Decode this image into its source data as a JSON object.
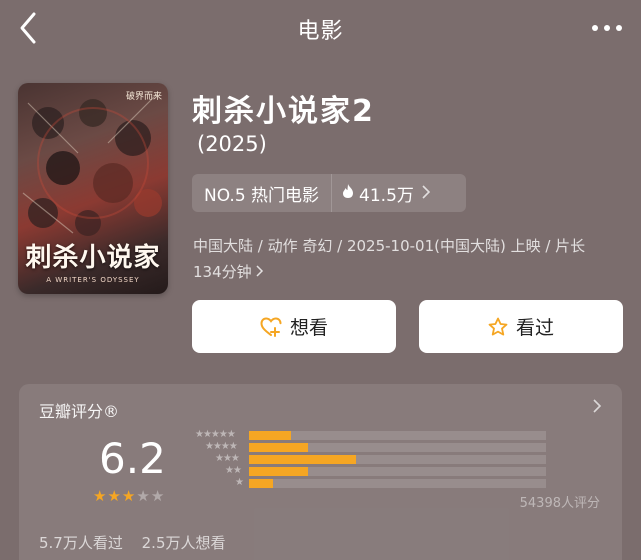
{
  "nav": {
    "title": "电影",
    "back_icon": "back-chevron-icon",
    "more_icon": "more-dots-icon"
  },
  "movie": {
    "title": "刺杀小说家2",
    "year": "(2025)",
    "poster": {
      "title": "刺杀小说家",
      "tag": "破界而来",
      "subtitle": "A WRITER'S ODYSSEY"
    },
    "rank": "NO.5 热门电影",
    "heat": "41.5万",
    "meta_line1": "中国大陆 / 动作 奇幻 / 2025-10-01(中国大陆) 上映 / 片长",
    "meta_line2": "134分钟"
  },
  "actions": {
    "want_label": "想看",
    "seen_label": "看过"
  },
  "rating": {
    "header": "豆瓣评分®",
    "score": "6.2",
    "stars": 3,
    "distribution": [
      {
        "stars": "★★★★★",
        "value": 0.14
      },
      {
        "stars": "★★★★",
        "value": 0.2
      },
      {
        "stars": "★★★",
        "value": 0.36
      },
      {
        "stars": "★★",
        "value": 0.2
      },
      {
        "stars": "★",
        "value": 0.08
      }
    ],
    "count": "54398人评分",
    "seen": "5.7万人看过",
    "want": "2.5万人想看"
  },
  "colors": {
    "accent": "#f5a623",
    "background": "#7b6d6d"
  }
}
